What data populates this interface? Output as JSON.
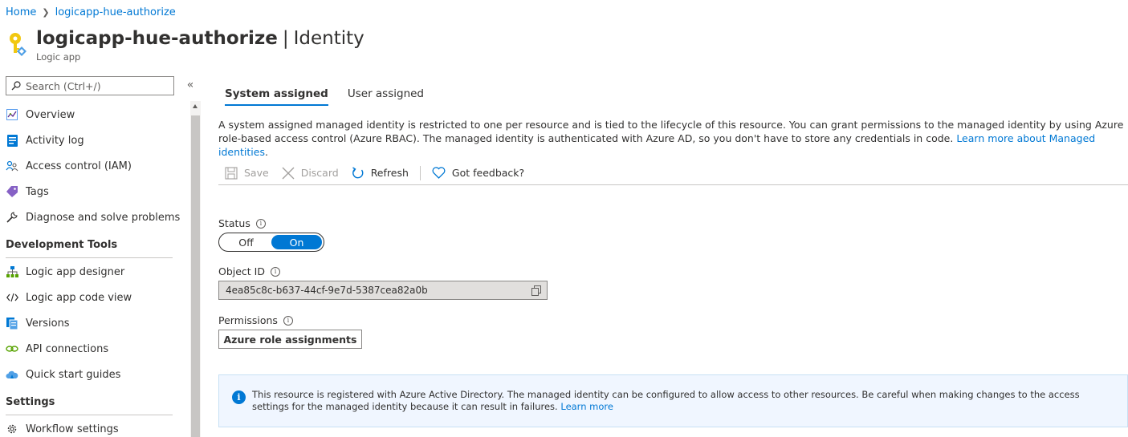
{
  "breadcrumb": {
    "home": "Home",
    "current": "logicapp-hue-authorize"
  },
  "header": {
    "resource_name": "logicapp-hue-authorize",
    "separator": "|",
    "blade_name": "Identity",
    "subtitle": "Logic app"
  },
  "sidebar": {
    "search_placeholder": "Search (Ctrl+/)",
    "collapse_glyph": "«",
    "items": [
      {
        "label": "Overview",
        "icon": "overview-icon"
      },
      {
        "label": "Activity log",
        "icon": "activity-log-icon"
      },
      {
        "label": "Access control (IAM)",
        "icon": "people-icon"
      },
      {
        "label": "Tags",
        "icon": "tag-icon"
      },
      {
        "label": "Diagnose and solve problems",
        "icon": "wrench-icon"
      }
    ],
    "sections": [
      {
        "title": "Development Tools",
        "items": [
          {
            "label": "Logic app designer",
            "icon": "designer-icon"
          },
          {
            "label": "Logic app code view",
            "icon": "code-icon"
          },
          {
            "label": "Versions",
            "icon": "versions-icon"
          },
          {
            "label": "API connections",
            "icon": "link-icon"
          },
          {
            "label": "Quick start guides",
            "icon": "cloud-icon"
          }
        ]
      },
      {
        "title": "Settings",
        "items": [
          {
            "label": "Workflow settings",
            "icon": "gear-icon"
          }
        ]
      }
    ]
  },
  "tabs": [
    {
      "label": "System assigned",
      "active": true
    },
    {
      "label": "User assigned",
      "active": false
    }
  ],
  "description": {
    "text": "A system assigned managed identity is restricted to one per resource and is tied to the lifecycle of this resource. You can grant permissions to the managed identity by using Azure role-based access control (Azure RBAC). The managed identity is authenticated with Azure AD, so you don't have to store any credentials in code. ",
    "link": "Learn more about Managed identities",
    "end": "."
  },
  "toolbar": {
    "save": "Save",
    "discard": "Discard",
    "refresh": "Refresh",
    "feedback": "Got feedback?"
  },
  "status": {
    "label": "Status",
    "off": "Off",
    "on": "On",
    "value": "On"
  },
  "object_id": {
    "label": "Object ID",
    "value": "4ea85c8c-b637-44cf-9e7d-5387cea82a0b"
  },
  "permissions": {
    "label": "Permissions",
    "button": "Azure role assignments"
  },
  "banner": {
    "text": "This resource is registered with Azure Active Directory. The managed identity can be configured to allow access to other resources. Be careful when making changes to the access settings for the managed identity because it can result in failures. ",
    "link": "Learn more"
  },
  "colors": {
    "accent": "#0078d4",
    "banner_bg": "#f0f6ff"
  }
}
